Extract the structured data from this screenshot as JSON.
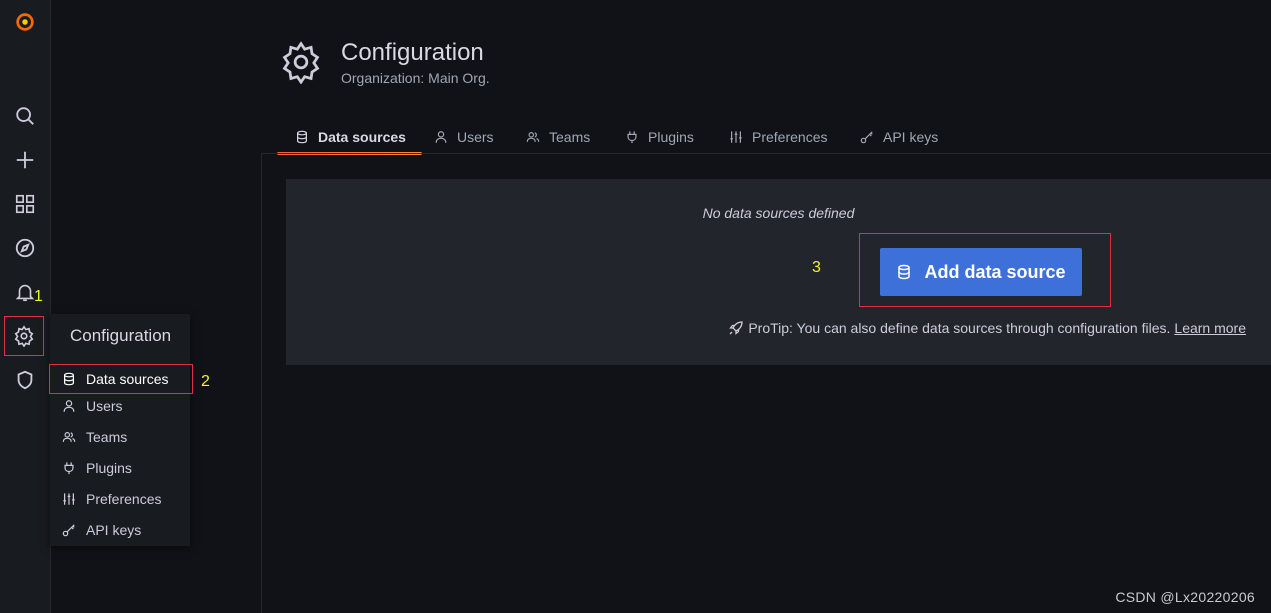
{
  "sidebar": {
    "icons": [
      "grafana-logo-icon",
      "search-icon",
      "plus-icon",
      "dashboards-icon",
      "explore-icon",
      "alerting-bell-icon",
      "gear-icon",
      "shield-icon"
    ]
  },
  "annotations": {
    "one": "1",
    "two": "2",
    "three": "3"
  },
  "flyout": {
    "title": "Configuration",
    "items": [
      {
        "label": "Data sources",
        "icon": "database-icon"
      },
      {
        "label": "Users",
        "icon": "user-icon"
      },
      {
        "label": "Teams",
        "icon": "users-icon"
      },
      {
        "label": "Plugins",
        "icon": "plug-icon"
      },
      {
        "label": "Preferences",
        "icon": "sliders-icon"
      },
      {
        "label": "API keys",
        "icon": "key-icon"
      }
    ]
  },
  "header": {
    "title": "Configuration",
    "subtitle": "Organization: Main Org."
  },
  "tabs": [
    {
      "label": "Data sources",
      "icon": "database-icon",
      "active": true
    },
    {
      "label": "Users",
      "icon": "user-icon"
    },
    {
      "label": "Teams",
      "icon": "users-icon"
    },
    {
      "label": "Plugins",
      "icon": "plug-icon"
    },
    {
      "label": "Preferences",
      "icon": "sliders-icon"
    },
    {
      "label": "API keys",
      "icon": "key-icon"
    }
  ],
  "empty_state": {
    "title": "No data sources defined",
    "button_label": "Add data source",
    "protip": "ProTip: You can also define data sources through configuration files.",
    "learn_more": "Learn more"
  },
  "watermark": "CSDN @Lx20220206",
  "colors": {
    "background": "#111217",
    "sidebar": "#181b1f",
    "panel": "#22252b",
    "primary_button": "#3d71d9",
    "tab_active_underline": "#ff8833",
    "annotation_box": "#e02f44",
    "annotation_text": "#f2f22e"
  }
}
